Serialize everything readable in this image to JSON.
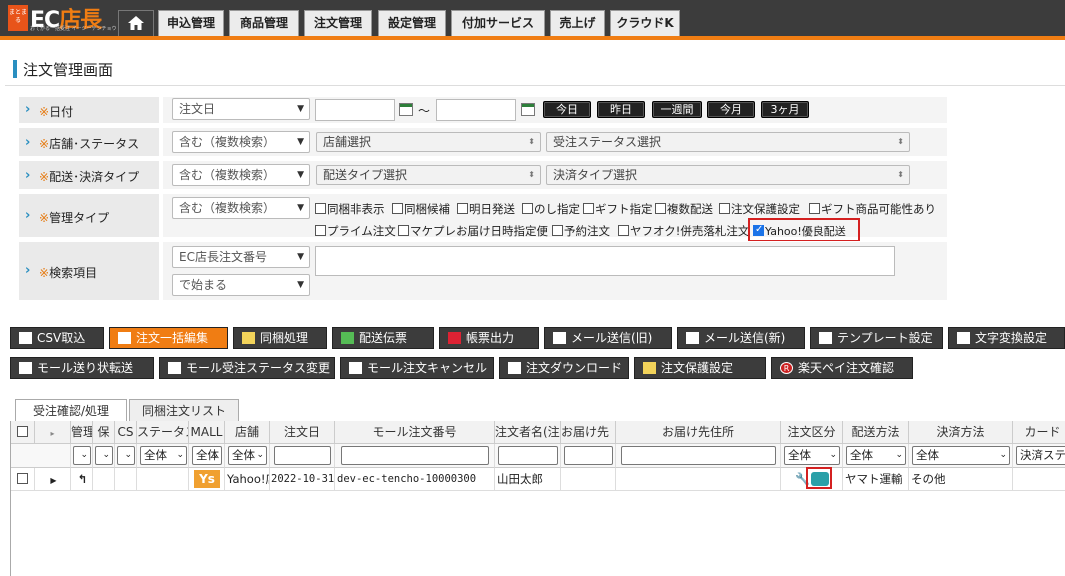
{
  "header": {
    "logo_badge": "まとまる",
    "logo_text": "EC",
    "logo_text2": "店長",
    "logo_sub": "おてがる一括受注 イージーテンチョウ",
    "nav": [
      "申込管理",
      "商品管理",
      "注文管理",
      "設定管理",
      "付加サービス",
      "売上げ",
      "クラウドK"
    ]
  },
  "page_title": "注文管理画面",
  "search": {
    "rows": [
      {
        "label": "日付"
      },
      {
        "label": "店舗･ステータス"
      },
      {
        "label": "配送･決済タイプ"
      },
      {
        "label": "管理タイプ"
      },
      {
        "label": "検索項目"
      }
    ],
    "required_mark": "※",
    "date_select": "注文日",
    "tilde": "～",
    "date_buttons": [
      "今日",
      "昨日",
      "一週間",
      "今月",
      "3ヶ月"
    ],
    "include_select": "含む（複数検索）",
    "shop_select": "店舗選択",
    "status_select": "受注ステータス選択",
    "delivery_select": "配送タイプ選択",
    "payment_select": "決済タイプ選択",
    "mgmt_checks_row1": [
      "同梱非表示",
      "同梱候補",
      "明日発送",
      "のし指定",
      "ギフト指定",
      "複数配送",
      "注文保護設定",
      "ギフト商品可能性あり"
    ],
    "mgmt_checks_row2": [
      "プライム注文",
      "マケプレお届け日時指定便",
      "予約注文",
      "ヤフオク!併売落札注文"
    ],
    "yahoo_check": "Yahoo!優良配送",
    "field_select": "EC店長注文番号",
    "match_select": "で始まる"
  },
  "toolbar1": [
    "CSV取込",
    "注文一括編集",
    "同梱処理",
    "配送伝票",
    "帳票出力",
    "メール送信(旧)",
    "メール送信(新)",
    "テンプレート設定",
    "文字変換設定"
  ],
  "toolbar2": [
    "モール送り状転送",
    "モール受注ステータス変更",
    "モール注文キャンセル",
    "注文ダウンロード",
    "注文保護設定",
    "楽天ペイ注文確認"
  ],
  "raku_badge": "R",
  "tabs": [
    "受注確認/処理",
    "同梱注文リスト"
  ],
  "grid": {
    "headers": [
      "管理",
      "保",
      "CS",
      "ステータス",
      "MALL",
      "店舗",
      "注文日",
      "モール注文番号",
      "注文者名(注",
      "お届け先",
      "お届け先住所",
      "注文区分",
      "配送方法",
      "決済方法",
      "カード"
    ],
    "filters": {
      "all": "全体",
      "mall": "全体",
      "shop": "全体",
      "kubun": "全体",
      "haiso": "全体",
      "kessai": "全体",
      "card": "決済ステ"
    },
    "row": {
      "mall_badge": "Ys",
      "shop": "Yahoo!店",
      "date": "2022-10-31",
      "order_no": "dev-ec-tencho-10000300",
      "name": "山田太郎",
      "delivery": "ヤマト運輸",
      "payment": "その他"
    }
  }
}
